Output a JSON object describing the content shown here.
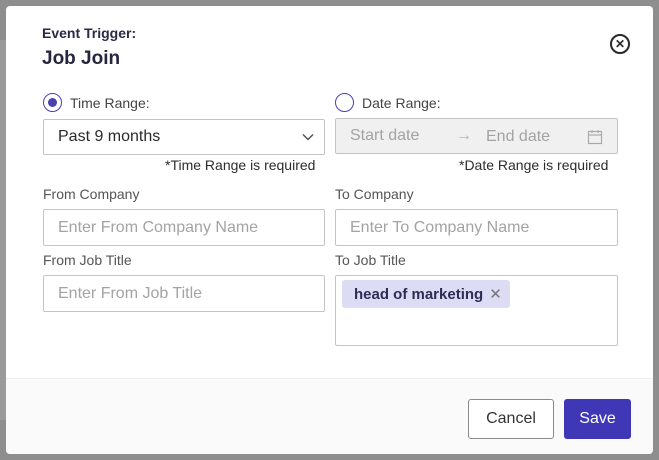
{
  "header": {
    "subtitle": "Event Trigger:",
    "title": "Job Join"
  },
  "time_range": {
    "label": "Time Range:",
    "selected": true,
    "value": "Past 9 months",
    "required_note": "*Time Range is required"
  },
  "date_range": {
    "label": "Date Range:",
    "selected": false,
    "start_placeholder": "Start date",
    "end_placeholder": "End date",
    "required_note": "*Date Range is required"
  },
  "from_company": {
    "label": "From Company",
    "placeholder": "Enter From Company Name"
  },
  "to_company": {
    "label": "To Company",
    "placeholder": "Enter To Company Name"
  },
  "from_job_title": {
    "label": "From Job Title",
    "placeholder": "Enter From Job Title"
  },
  "to_job_title": {
    "label": "To Job Title",
    "tags": [
      "head of marketing"
    ]
  },
  "footer": {
    "cancel_label": "Cancel",
    "save_label": "Save"
  },
  "colors": {
    "accent": "#3f37b5",
    "tag_bg": "#dcdcf5"
  }
}
